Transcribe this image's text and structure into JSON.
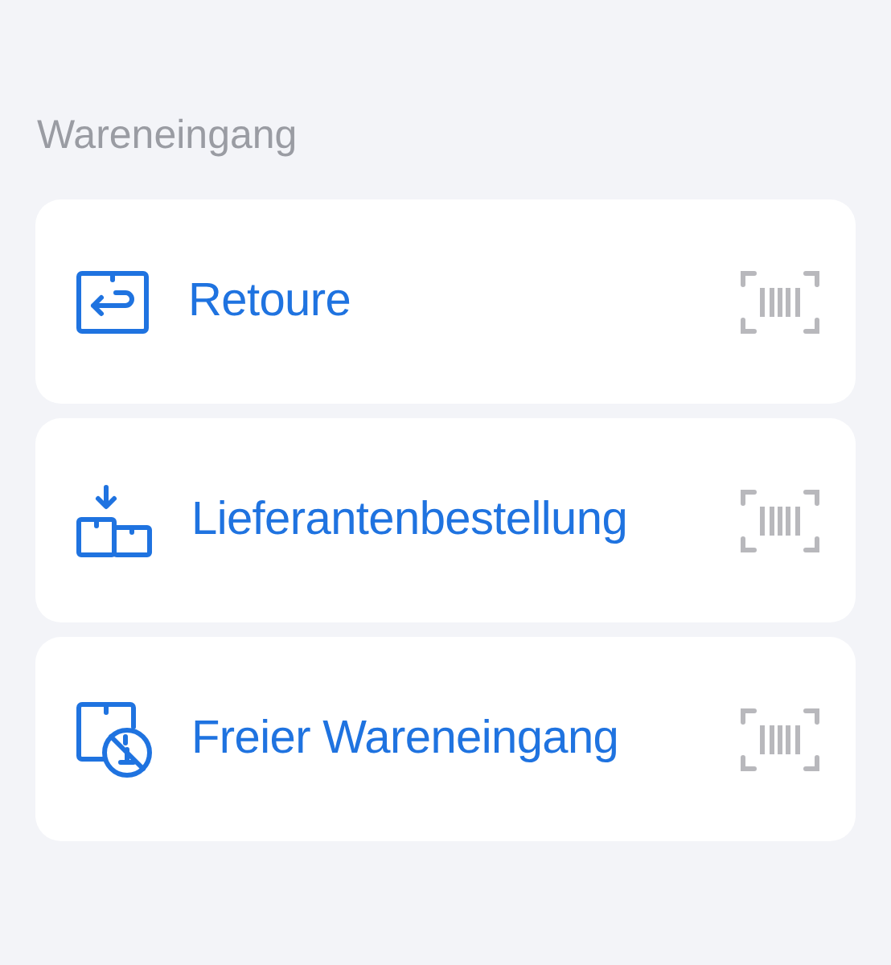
{
  "section_title": "Wareneingang",
  "items": [
    {
      "kind": "return",
      "label": "Retoure"
    },
    {
      "kind": "supplier",
      "label": "Lieferantenbestellung"
    },
    {
      "kind": "free",
      "label": "Freier Wareneingang"
    }
  ]
}
